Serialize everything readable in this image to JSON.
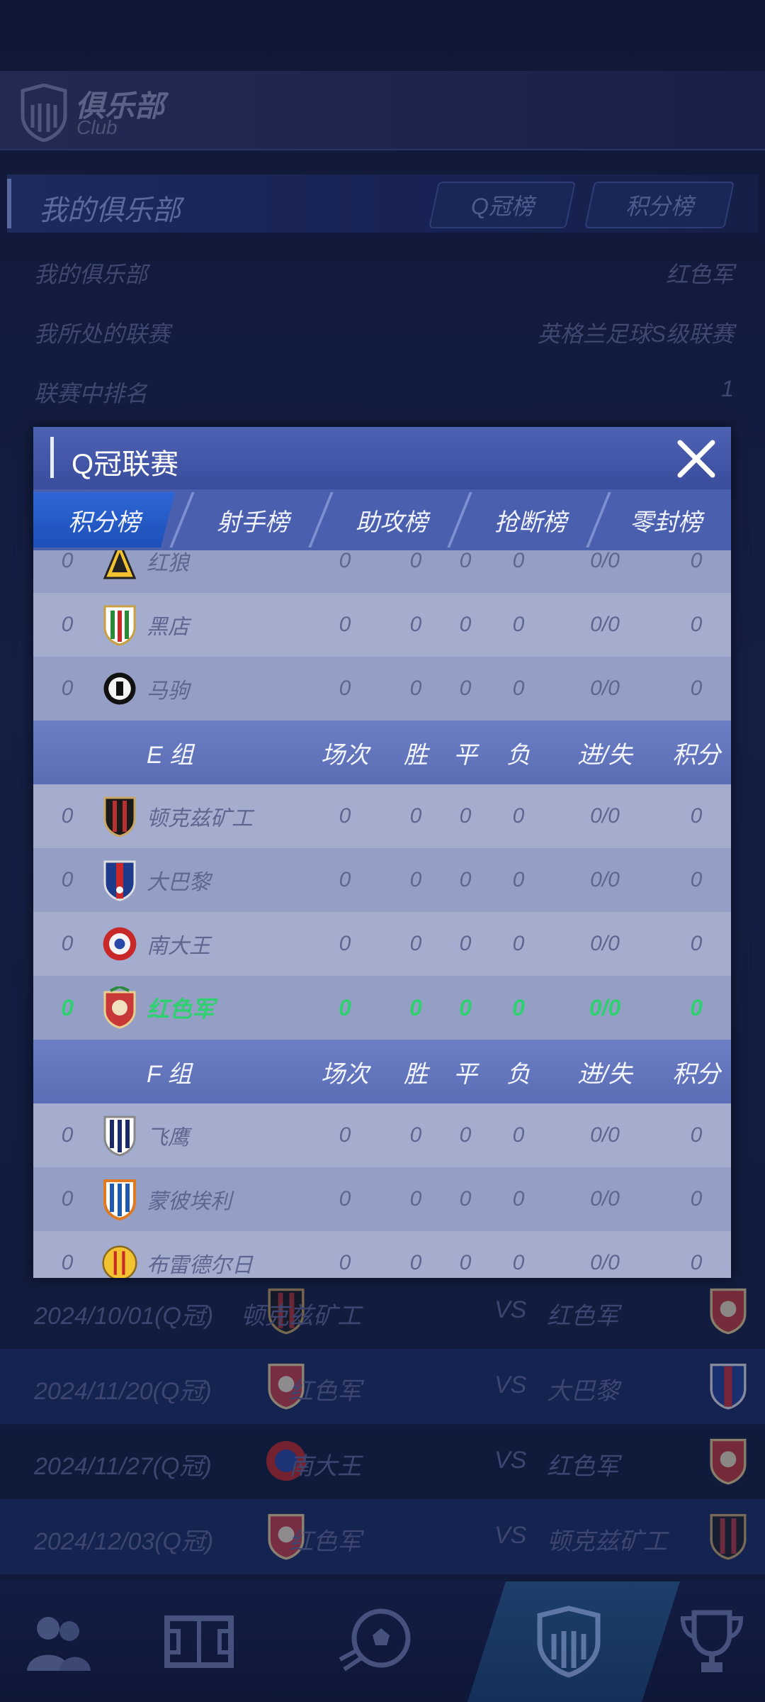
{
  "header": {
    "title": "俱乐部",
    "subtitle": "Club"
  },
  "section": {
    "title": "我的俱乐部",
    "btn_q": "Q冠榜",
    "btn_points": "积分榜"
  },
  "info": [
    {
      "label": "我的俱乐部",
      "value": "红色军"
    },
    {
      "label": "我所处的联赛",
      "value": "英格兰足球S级联赛"
    },
    {
      "label": "联赛中排名",
      "value": "1"
    }
  ],
  "matches": [
    {
      "date": "2024/10/01(Q冠)",
      "home": "顿克兹矿工",
      "vs": "VS",
      "away": "红色军"
    },
    {
      "date": "2024/11/20(Q冠)",
      "home": "红色军",
      "vs": "VS",
      "away": "大巴黎"
    },
    {
      "date": "2024/11/27(Q冠)",
      "home": "南大王",
      "vs": "VS",
      "away": "红色军"
    },
    {
      "date": "2024/12/03(Q冠)",
      "home": "红色军",
      "vs": "VS",
      "away": "顿克兹矿工"
    }
  ],
  "modal": {
    "title": "Q冠联赛",
    "tabs": [
      "积分榜",
      "射手榜",
      "助攻榜",
      "抢断榜",
      "零封榜"
    ],
    "rows": [
      {
        "type": "team",
        "rank": "0",
        "name": "红狼",
        "mp": "0",
        "w": "0",
        "d": "0",
        "l": "0",
        "gd": "0/0",
        "pts": "0"
      },
      {
        "type": "team",
        "rank": "0",
        "name": "黑店",
        "mp": "0",
        "w": "0",
        "d": "0",
        "l": "0",
        "gd": "0/0",
        "pts": "0"
      },
      {
        "type": "team",
        "rank": "0",
        "name": "马驹",
        "mp": "0",
        "w": "0",
        "d": "0",
        "l": "0",
        "gd": "0/0",
        "pts": "0"
      },
      {
        "type": "header",
        "name": "E 组",
        "mp": "场次",
        "w": "胜",
        "d": "平",
        "l": "负",
        "gd": "进/失",
        "pts": "积分"
      },
      {
        "type": "team",
        "rank": "0",
        "name": "顿克兹矿工",
        "mp": "0",
        "w": "0",
        "d": "0",
        "l": "0",
        "gd": "0/0",
        "pts": "0"
      },
      {
        "type": "team",
        "rank": "0",
        "name": "大巴黎",
        "mp": "0",
        "w": "0",
        "d": "0",
        "l": "0",
        "gd": "0/0",
        "pts": "0"
      },
      {
        "type": "team",
        "rank": "0",
        "name": "南大王",
        "mp": "0",
        "w": "0",
        "d": "0",
        "l": "0",
        "gd": "0/0",
        "pts": "0"
      },
      {
        "type": "me",
        "rank": "0",
        "name": "红色军",
        "mp": "0",
        "w": "0",
        "d": "0",
        "l": "0",
        "gd": "0/0",
        "pts": "0"
      },
      {
        "type": "header",
        "name": "F 组",
        "mp": "场次",
        "w": "胜",
        "d": "平",
        "l": "负",
        "gd": "进/失",
        "pts": "积分"
      },
      {
        "type": "team",
        "rank": "0",
        "name": "飞鹰",
        "mp": "0",
        "w": "0",
        "d": "0",
        "l": "0",
        "gd": "0/0",
        "pts": "0"
      },
      {
        "type": "team",
        "rank": "0",
        "name": "蒙彼埃利",
        "mp": "0",
        "w": "0",
        "d": "0",
        "l": "0",
        "gd": "0/0",
        "pts": "0"
      },
      {
        "type": "team",
        "rank": "0",
        "name": "布雷德尔日",
        "mp": "0",
        "w": "0",
        "d": "0",
        "l": "0",
        "gd": "0/0",
        "pts": "0"
      }
    ]
  },
  "colors": {
    "highlight": "#2fd070",
    "modal_bg": "#a3abcd",
    "tab_active": "#2d67d6"
  },
  "nav": [
    "team-icon",
    "pitch-icon",
    "ball-icon",
    "club-icon",
    "trophy-icon"
  ]
}
